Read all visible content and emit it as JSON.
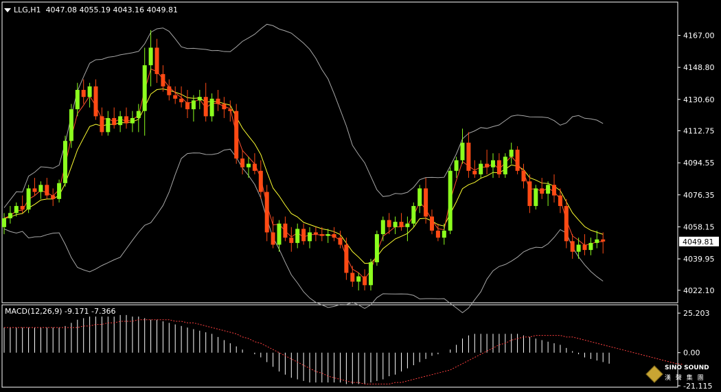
{
  "symbol": "LLG,H1",
  "ohlc": "4047.08 4055.19 4043.16 4049.81",
  "macd_title": "MACD(12,26,9) -9.171 -7.366",
  "logo": {
    "title": "SINO SOUND",
    "subtitle": "漢 聲 集 團"
  },
  "colors": {
    "bull": "#8cff1e",
    "bear": "#ff4a14",
    "ma_fast": "#ff5030",
    "ma_slow": "#ffff30",
    "band": "#a8a8a8",
    "grid": "#ffffff",
    "macd_hist": "#ffffff",
    "macd_signal": "#ff4040"
  },
  "chart_data": [
    {
      "type": "candlestick",
      "name": "price",
      "ylim": [
        4015,
        4175
      ],
      "y_ticks": [
        "4167.00",
        "4148.80",
        "4130.60",
        "4112.75",
        "4094.55",
        "4076.35",
        "4058.15",
        "4039.95",
        "4022.10"
      ],
      "current_price_label": "4049.81",
      "candles": [
        [
          4058,
          4066,
          4054,
          4063
        ],
        [
          4063,
          4070,
          4060,
          4066
        ],
        [
          4066,
          4072,
          4064,
          4070
        ],
        [
          4070,
          4076,
          4066,
          4068
        ],
        [
          4068,
          4082,
          4066,
          4080
        ],
        [
          4080,
          4086,
          4076,
          4078
        ],
        [
          4078,
          4084,
          4074,
          4082
        ],
        [
          4082,
          4086,
          4074,
          4076
        ],
        [
          4076,
          4080,
          4070,
          4074
        ],
        [
          4074,
          4085,
          4072,
          4083
        ],
        [
          4083,
          4110,
          4081,
          4107
        ],
        [
          4107,
          4128,
          4103,
          4125
        ],
        [
          4125,
          4140,
          4121,
          4136
        ],
        [
          4136,
          4142,
          4128,
          4132
        ],
        [
          4132,
          4140,
          4126,
          4138
        ],
        [
          4138,
          4142,
          4119,
          4121
        ],
        [
          4121,
          4126,
          4110,
          4112
        ],
        [
          4112,
          4124,
          4110,
          4120
        ],
        [
          4120,
          4126,
          4114,
          4116
        ],
        [
          4116,
          4124,
          4112,
          4121
        ],
        [
          4121,
          4126,
          4114,
          4117
        ],
        [
          4117,
          4124,
          4112,
          4120
        ],
        [
          4120,
          4128,
          4112,
          4124
        ],
        [
          4124,
          4160,
          4110,
          4150
        ],
        [
          4150,
          4170,
          4138,
          4160
        ],
        [
          4160,
          4165,
          4140,
          4145
        ],
        [
          4145,
          4150,
          4135,
          4138
        ],
        [
          4138,
          4142,
          4130,
          4133
        ],
        [
          4133,
          4138,
          4128,
          4131
        ],
        [
          4131,
          4138,
          4126,
          4129
        ],
        [
          4129,
          4136,
          4120,
          4125
        ],
        [
          4125,
          4133,
          4118,
          4130
        ],
        [
          4130,
          4136,
          4125,
          4132
        ],
        [
          4132,
          4140,
          4118,
          4121
        ],
        [
          4121,
          4134,
          4118,
          4131
        ],
        [
          4131,
          4136,
          4124,
          4128
        ],
        [
          4128,
          4132,
          4120,
          4125
        ],
        [
          4125,
          4130,
          4118,
          4124
        ],
        [
          4124,
          4128,
          4094,
          4097
        ],
        [
          4097,
          4102,
          4088,
          4092
        ],
        [
          4092,
          4098,
          4086,
          4094
        ],
        [
          4094,
          4100,
          4088,
          4090
        ],
        [
          4090,
          4096,
          4074,
          4078
        ],
        [
          4078,
          4082,
          4050,
          4055
        ],
        [
          4055,
          4064,
          4046,
          4048
        ],
        [
          4048,
          4062,
          4044,
          4060
        ],
        [
          4060,
          4064,
          4050,
          4052
        ],
        [
          4052,
          4058,
          4044,
          4049
        ],
        [
          4049,
          4060,
          4046,
          4057
        ],
        [
          4057,
          4060,
          4048,
          4050
        ],
        [
          4050,
          4058,
          4046,
          4055
        ],
        [
          4055,
          4058,
          4050,
          4054
        ],
        [
          4054,
          4058,
          4050,
          4053
        ],
        [
          4053,
          4057,
          4049,
          4054
        ],
        [
          4054,
          4058,
          4050,
          4052
        ],
        [
          4052,
          4056,
          4046,
          4048
        ],
        [
          4048,
          4052,
          4028,
          4032
        ],
        [
          4032,
          4036,
          4024,
          4027
        ],
        [
          4027,
          4032,
          4022,
          4030
        ],
        [
          4030,
          4034,
          4022,
          4025
        ],
        [
          4025,
          4040,
          4022,
          4038
        ],
        [
          4038,
          4056,
          4036,
          4054
        ],
        [
          4054,
          4064,
          4050,
          4062
        ],
        [
          4062,
          4066,
          4054,
          4058
        ],
        [
          4058,
          4064,
          4054,
          4061
        ],
        [
          4061,
          4066,
          4056,
          4058
        ],
        [
          4058,
          4064,
          4050,
          4060
        ],
        [
          4060,
          4072,
          4058,
          4070
        ],
        [
          4070,
          4082,
          4066,
          4080
        ],
        [
          4080,
          4086,
          4060,
          4064
        ],
        [
          4064,
          4068,
          4054,
          4056
        ],
        [
          4056,
          4060,
          4050,
          4052
        ],
        [
          4052,
          4060,
          4048,
          4056
        ],
        [
          4056,
          4092,
          4054,
          4090
        ],
        [
          4090,
          4098,
          4086,
          4096
        ],
        [
          4096,
          4114,
          4094,
          4106
        ],
        [
          4106,
          4112,
          4086,
          4090
        ],
        [
          4090,
          4096,
          4086,
          4088
        ],
        [
          4088,
          4096,
          4086,
          4094
        ],
        [
          4094,
          4102,
          4088,
          4092
        ],
        [
          4092,
          4100,
          4086,
          4096
        ],
        [
          4096,
          4100,
          4086,
          4088
        ],
        [
          4088,
          4100,
          4086,
          4098
        ],
        [
          4098,
          4106,
          4094,
          4102
        ],
        [
          4102,
          4104,
          4088,
          4090
        ],
        [
          4090,
          4094,
          4080,
          4084
        ],
        [
          4084,
          4088,
          4066,
          4070
        ],
        [
          4070,
          4082,
          4068,
          4080
        ],
        [
          4080,
          4086,
          4074,
          4077
        ],
        [
          4077,
          4084,
          4070,
          4082
        ],
        [
          4082,
          4088,
          4072,
          4076
        ],
        [
          4076,
          4080,
          4066,
          4070
        ],
        [
          4070,
          4074,
          4046,
          4050
        ],
        [
          4050,
          4054,
          4040,
          4044
        ],
        [
          4044,
          4052,
          4040,
          4048
        ],
        [
          4048,
          4054,
          4042,
          4045
        ],
        [
          4045,
          4052,
          4042,
          4049
        ],
        [
          4049,
          4056,
          4046,
          4051
        ],
        [
          4051,
          4055,
          4043,
          4049.81
        ]
      ]
    },
    {
      "type": "macd",
      "name": "MACD(12,26,9)",
      "ylim": [
        -22,
        27
      ],
      "y_ticks": [
        "25.203",
        "0.00",
        "-21.115"
      ],
      "histogram": [
        16,
        16,
        16,
        16,
        16,
        16,
        16,
        16,
        16,
        16,
        17,
        19,
        21,
        22,
        23,
        23,
        23,
        23,
        23,
        24,
        24,
        23,
        23,
        22,
        21,
        21,
        20,
        19,
        18,
        17,
        16,
        15,
        14,
        13,
        12,
        10,
        8,
        6,
        4,
        2,
        0,
        -1,
        -3,
        -6,
        -9,
        -12,
        -14,
        -16,
        -17,
        -18,
        -19,
        -19,
        -19,
        -19,
        -19,
        -19,
        -20,
        -20,
        -20,
        -20,
        -19,
        -18,
        -17,
        -15,
        -14,
        -12,
        -10,
        -8,
        -6,
        -4,
        -2,
        -1,
        0,
        2,
        5,
        9,
        11,
        12,
        12,
        12,
        12,
        12,
        12,
        12,
        12,
        11,
        10,
        9,
        8,
        7,
        6,
        5,
        3,
        1,
        -1,
        -3,
        -4,
        -5,
        -6,
        -7
      ],
      "signal": [
        16,
        16,
        16,
        16,
        16,
        16,
        16,
        16,
        16,
        16,
        16,
        16,
        16,
        17,
        17,
        18,
        18,
        19,
        19,
        20,
        20,
        20,
        21,
        21,
        21,
        21,
        21,
        21,
        20,
        20,
        19,
        19,
        18,
        17,
        16,
        15,
        14,
        13,
        12,
        10,
        9,
        7,
        6,
        4,
        2,
        0,
        -2,
        -4,
        -6,
        -8,
        -10,
        -12,
        -13,
        -15,
        -16,
        -17,
        -18,
        -19,
        -19,
        -20,
        -20,
        -20,
        -20,
        -20,
        -19,
        -19,
        -18,
        -17,
        -16,
        -15,
        -14,
        -13,
        -12,
        -11,
        -9,
        -7,
        -5,
        -3,
        -1,
        1,
        3,
        5,
        6,
        8,
        9,
        10,
        10,
        11,
        11,
        11,
        11,
        11,
        10,
        10,
        9,
        8,
        7,
        6,
        5,
        4,
        3,
        2,
        1,
        0,
        -1,
        -2,
        -3,
        -4,
        -5,
        -6,
        -7,
        -7.4
      ]
    }
  ]
}
